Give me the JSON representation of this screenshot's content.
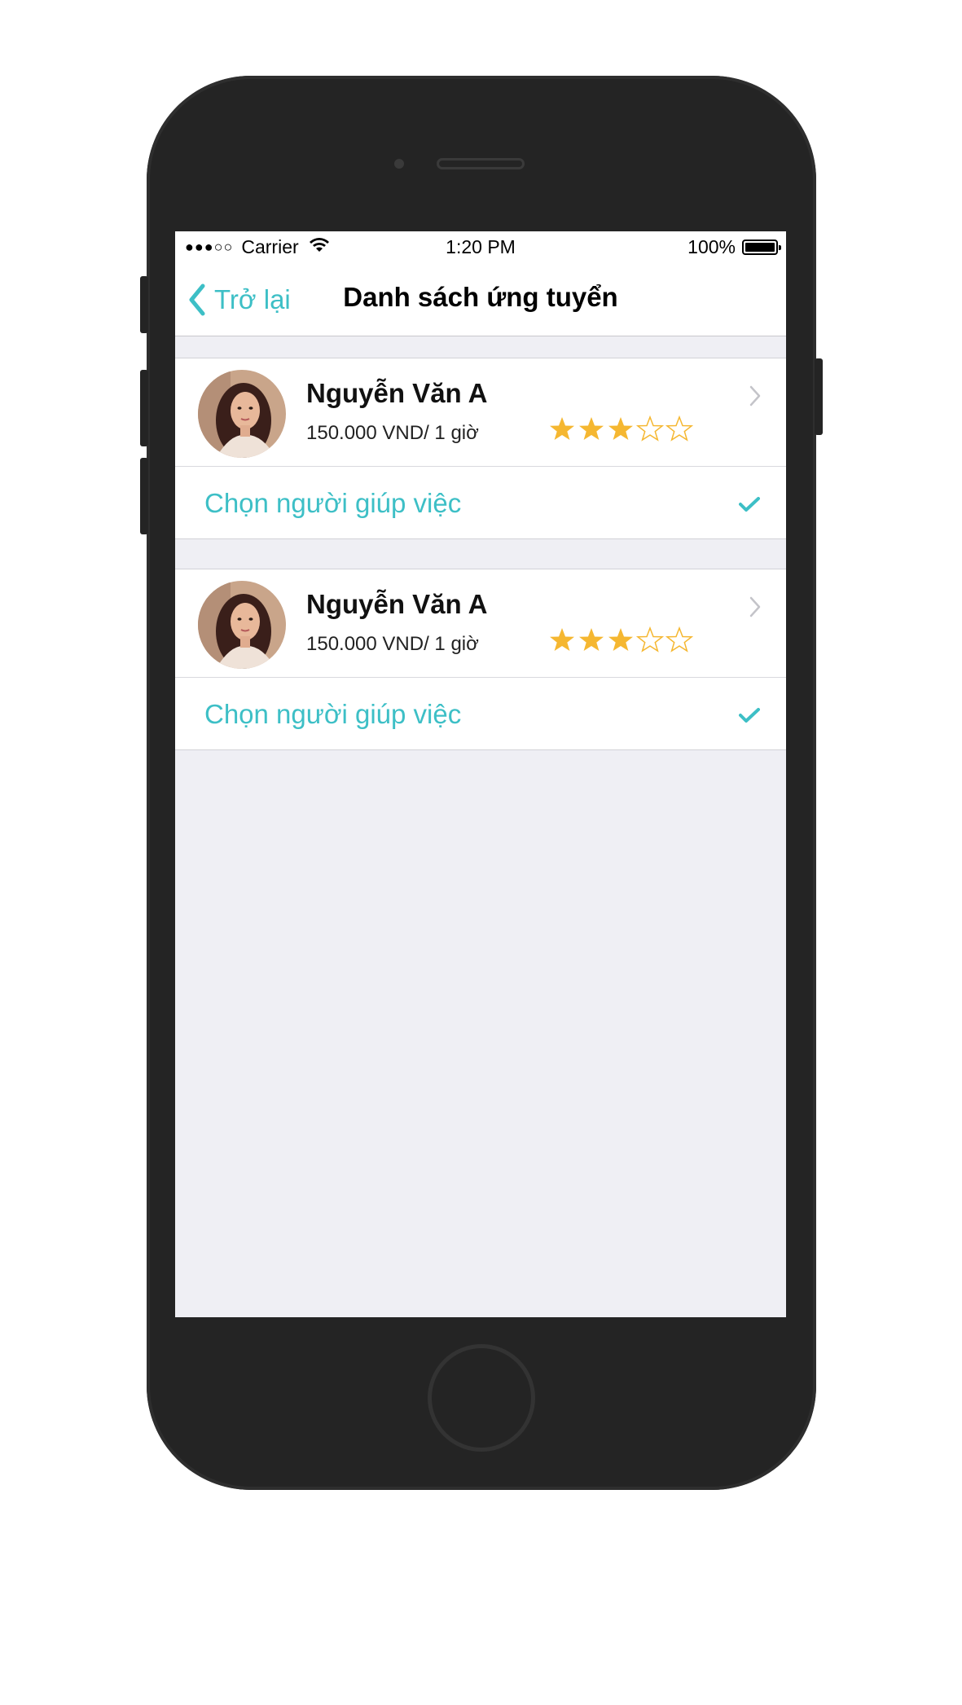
{
  "status_bar": {
    "signal": "●●●○○",
    "carrier": "Carrier",
    "time": "1:20 PM",
    "battery": "100%"
  },
  "nav": {
    "back_label": "Trở lại",
    "title": "Danh sách ứng tuyển"
  },
  "applicants": [
    {
      "name": "Nguyễn Văn A",
      "price": "150.000 VND/ 1 giờ",
      "rating": 3,
      "max_rating": 5,
      "action_label": "Chọn người giúp việc"
    },
    {
      "name": "Nguyễn Văn A",
      "price": "150.000 VND/ 1 giờ",
      "rating": 3,
      "max_rating": 5,
      "action_label": "Chọn người giúp việc"
    }
  ],
  "colors": {
    "accent": "#3dbfc6",
    "star": "#f5b731",
    "background": "#efeff4",
    "device": "#242424"
  }
}
